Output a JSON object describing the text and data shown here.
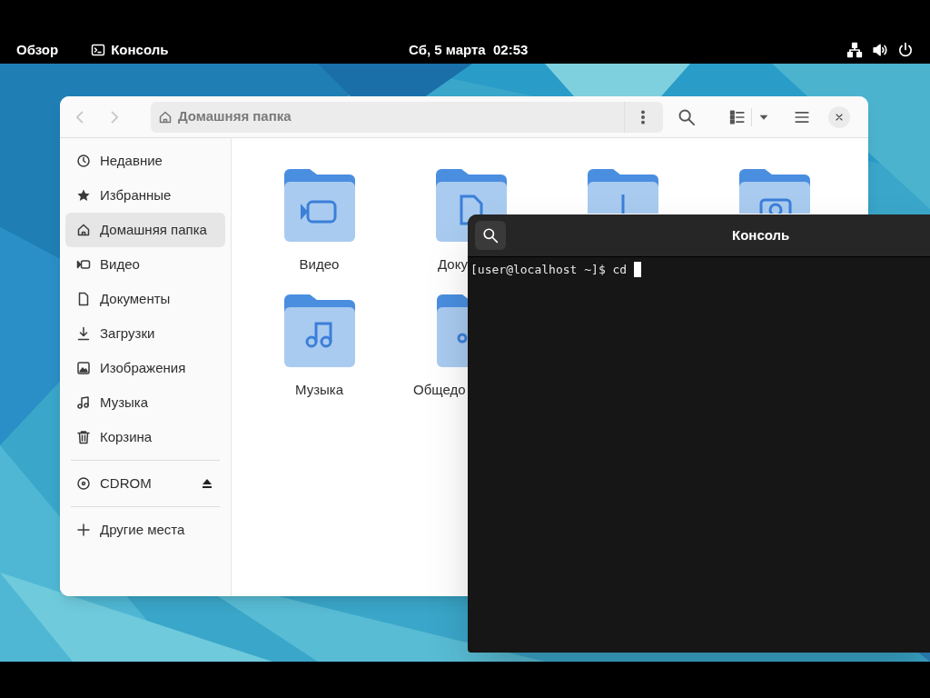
{
  "top_bar": {
    "overview": "Обзор",
    "app": "Консоль",
    "clock": "Сб, 5 марта  02:53"
  },
  "files": {
    "path": "Домашняя папка",
    "sidebar": {
      "places": [
        {
          "label": "Недавние",
          "selected": false
        },
        {
          "label": "Избранные",
          "selected": false
        },
        {
          "label": "Домашняя папка",
          "selected": true
        },
        {
          "label": "Видео",
          "selected": false
        },
        {
          "label": "Документы",
          "selected": false
        },
        {
          "label": "Загрузки",
          "selected": false
        },
        {
          "label": "Изображения",
          "selected": false
        },
        {
          "label": "Музыка",
          "selected": false
        },
        {
          "label": "Корзина",
          "selected": false
        }
      ],
      "devices": [
        {
          "label": "CDROM"
        }
      ],
      "other": [
        {
          "label": "Другие места"
        }
      ]
    },
    "folders": [
      {
        "label": "Видео"
      },
      {
        "label": "Доку"
      },
      {
        "label": "Музыка"
      },
      {
        "label": "Общедо"
      }
    ]
  },
  "terminal": {
    "title": "Консоль",
    "prompt": "[user@localhost ~]$ cd"
  }
}
